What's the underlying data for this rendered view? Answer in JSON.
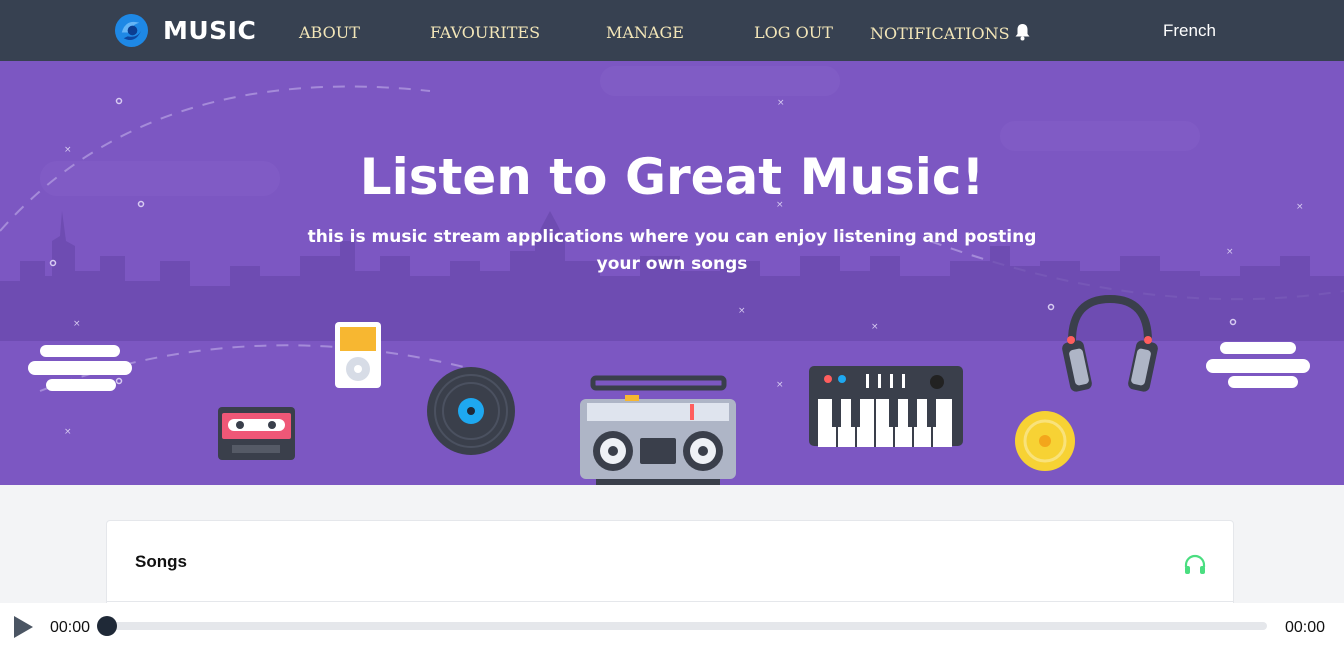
{
  "nav": {
    "logo_text": "MUSIC",
    "links": [
      "ABOUT",
      "FAVOURITES",
      "MANAGE",
      "LOG OUT",
      "NOTIFICATIONS"
    ],
    "language": "French"
  },
  "hero": {
    "title": "Listen to Great Music!",
    "subtitle": "this is music stream applications where you can enjoy listening and posting your own songs"
  },
  "songs_card": {
    "title": "Songs",
    "icon": "headphones-icon"
  },
  "player": {
    "current_time": "00:00",
    "duration": "00:00",
    "progress": 0
  },
  "colors": {
    "nav_bg": "#374151",
    "nav_link": "#f3e6b8",
    "hero_bg": "#7c57c2",
    "accent_green": "#4ade80"
  }
}
